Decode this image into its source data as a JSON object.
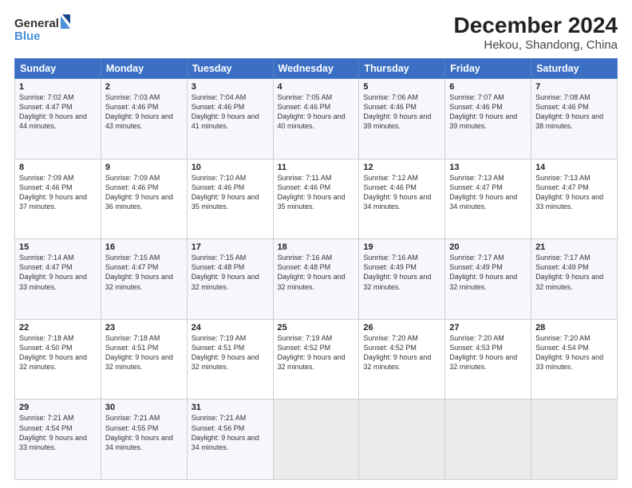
{
  "header": {
    "logo_line1": "General",
    "logo_line2": "Blue",
    "title": "December 2024",
    "subtitle": "Hekou, Shandong, China"
  },
  "days_of_week": [
    "Sunday",
    "Monday",
    "Tuesday",
    "Wednesday",
    "Thursday",
    "Friday",
    "Saturday"
  ],
  "weeks": [
    [
      {
        "day": 1,
        "sunrise": "7:02 AM",
        "sunset": "4:47 PM",
        "daylight": "9 hours and 44 minutes."
      },
      {
        "day": 2,
        "sunrise": "7:03 AM",
        "sunset": "4:46 PM",
        "daylight": "9 hours and 43 minutes."
      },
      {
        "day": 3,
        "sunrise": "7:04 AM",
        "sunset": "4:46 PM",
        "daylight": "9 hours and 41 minutes."
      },
      {
        "day": 4,
        "sunrise": "7:05 AM",
        "sunset": "4:46 PM",
        "daylight": "9 hours and 40 minutes."
      },
      {
        "day": 5,
        "sunrise": "7:06 AM",
        "sunset": "4:46 PM",
        "daylight": "9 hours and 39 minutes."
      },
      {
        "day": 6,
        "sunrise": "7:07 AM",
        "sunset": "4:46 PM",
        "daylight": "9 hours and 39 minutes."
      },
      {
        "day": 7,
        "sunrise": "7:08 AM",
        "sunset": "4:46 PM",
        "daylight": "9 hours and 38 minutes."
      }
    ],
    [
      {
        "day": 8,
        "sunrise": "7:09 AM",
        "sunset": "4:46 PM",
        "daylight": "9 hours and 37 minutes."
      },
      {
        "day": 9,
        "sunrise": "7:09 AM",
        "sunset": "4:46 PM",
        "daylight": "9 hours and 36 minutes."
      },
      {
        "day": 10,
        "sunrise": "7:10 AM",
        "sunset": "4:46 PM",
        "daylight": "9 hours and 35 minutes."
      },
      {
        "day": 11,
        "sunrise": "7:11 AM",
        "sunset": "4:46 PM",
        "daylight": "9 hours and 35 minutes."
      },
      {
        "day": 12,
        "sunrise": "7:12 AM",
        "sunset": "4:46 PM",
        "daylight": "9 hours and 34 minutes."
      },
      {
        "day": 13,
        "sunrise": "7:13 AM",
        "sunset": "4:47 PM",
        "daylight": "9 hours and 34 minutes."
      },
      {
        "day": 14,
        "sunrise": "7:13 AM",
        "sunset": "4:47 PM",
        "daylight": "9 hours and 33 minutes."
      }
    ],
    [
      {
        "day": 15,
        "sunrise": "7:14 AM",
        "sunset": "4:47 PM",
        "daylight": "9 hours and 33 minutes."
      },
      {
        "day": 16,
        "sunrise": "7:15 AM",
        "sunset": "4:47 PM",
        "daylight": "9 hours and 32 minutes."
      },
      {
        "day": 17,
        "sunrise": "7:15 AM",
        "sunset": "4:48 PM",
        "daylight": "9 hours and 32 minutes."
      },
      {
        "day": 18,
        "sunrise": "7:16 AM",
        "sunset": "4:48 PM",
        "daylight": "9 hours and 32 minutes."
      },
      {
        "day": 19,
        "sunrise": "7:16 AM",
        "sunset": "4:49 PM",
        "daylight": "9 hours and 32 minutes."
      },
      {
        "day": 20,
        "sunrise": "7:17 AM",
        "sunset": "4:49 PM",
        "daylight": "9 hours and 32 minutes."
      },
      {
        "day": 21,
        "sunrise": "7:17 AM",
        "sunset": "4:49 PM",
        "daylight": "9 hours and 32 minutes."
      }
    ],
    [
      {
        "day": 22,
        "sunrise": "7:18 AM",
        "sunset": "4:50 PM",
        "daylight": "9 hours and 32 minutes."
      },
      {
        "day": 23,
        "sunrise": "7:18 AM",
        "sunset": "4:51 PM",
        "daylight": "9 hours and 32 minutes."
      },
      {
        "day": 24,
        "sunrise": "7:19 AM",
        "sunset": "4:51 PM",
        "daylight": "9 hours and 32 minutes."
      },
      {
        "day": 25,
        "sunrise": "7:19 AM",
        "sunset": "4:52 PM",
        "daylight": "9 hours and 32 minutes."
      },
      {
        "day": 26,
        "sunrise": "7:20 AM",
        "sunset": "4:52 PM",
        "daylight": "9 hours and 32 minutes."
      },
      {
        "day": 27,
        "sunrise": "7:20 AM",
        "sunset": "4:53 PM",
        "daylight": "9 hours and 32 minutes."
      },
      {
        "day": 28,
        "sunrise": "7:20 AM",
        "sunset": "4:54 PM",
        "daylight": "9 hours and 33 minutes."
      }
    ],
    [
      {
        "day": 29,
        "sunrise": "7:21 AM",
        "sunset": "4:54 PM",
        "daylight": "9 hours and 33 minutes."
      },
      {
        "day": 30,
        "sunrise": "7:21 AM",
        "sunset": "4:55 PM",
        "daylight": "9 hours and 34 minutes."
      },
      {
        "day": 31,
        "sunrise": "7:21 AM",
        "sunset": "4:56 PM",
        "daylight": "9 hours and 34 minutes."
      },
      null,
      null,
      null,
      null
    ]
  ]
}
